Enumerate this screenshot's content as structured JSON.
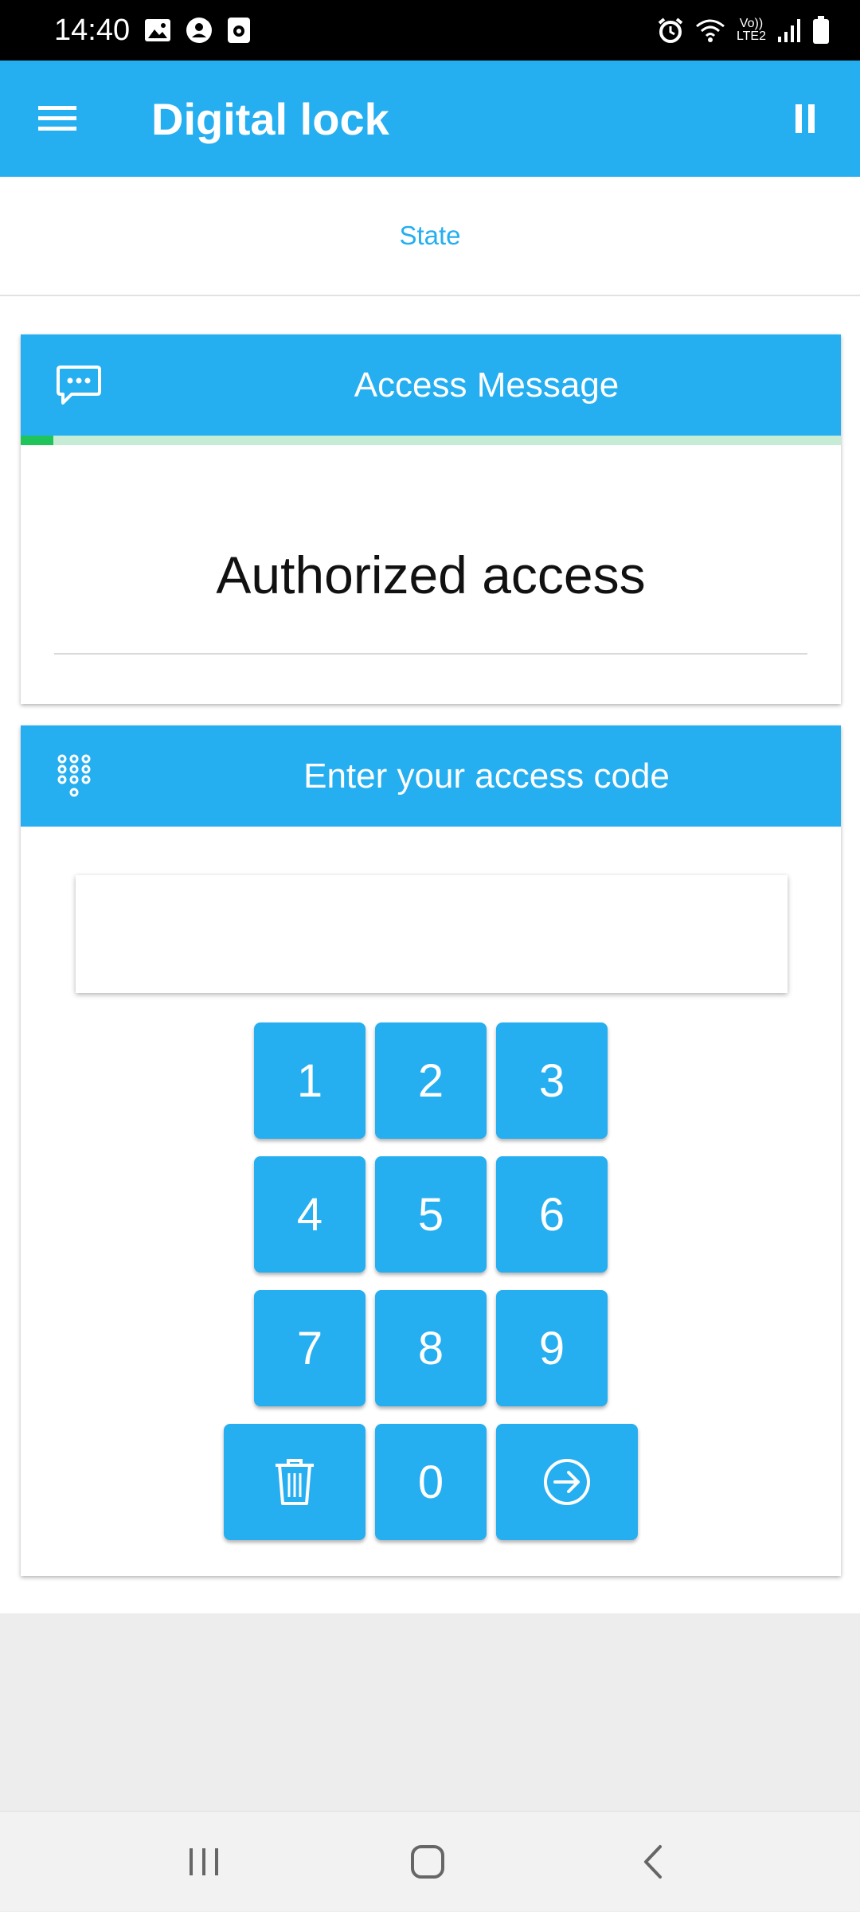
{
  "status_bar": {
    "time": "14:40",
    "network_top": "Vo))",
    "network_bottom": "LTE2",
    "icons": [
      "image-icon",
      "account-circle-icon",
      "media-icon",
      "alarm-icon",
      "wifi-icon",
      "signal-icon",
      "battery-icon"
    ]
  },
  "app_bar": {
    "title": "Digital lock",
    "menu_icon": "hamburger-menu-icon",
    "action_icon": "pause-icon"
  },
  "tabs": {
    "state_label": "State"
  },
  "access_message_card": {
    "title": "Access Message",
    "icon": "chat-bubble-icon",
    "progress": 0.04,
    "message": "Authorized access"
  },
  "access_code_card": {
    "title": "Enter your access code",
    "icon": "dialpad-icon",
    "code_value": "",
    "keys": [
      "1",
      "2",
      "3",
      "4",
      "5",
      "6",
      "7",
      "8",
      "9",
      "0"
    ],
    "delete_icon": "trash-icon",
    "submit_icon": "arrow-right-circle-icon"
  },
  "colors": {
    "primary": "#25aef0",
    "progress_fill": "#1fc55a",
    "progress_track": "#c6ecd5"
  },
  "nav_bar": {
    "icons": [
      "recent-apps-icon",
      "home-icon",
      "back-icon"
    ]
  }
}
